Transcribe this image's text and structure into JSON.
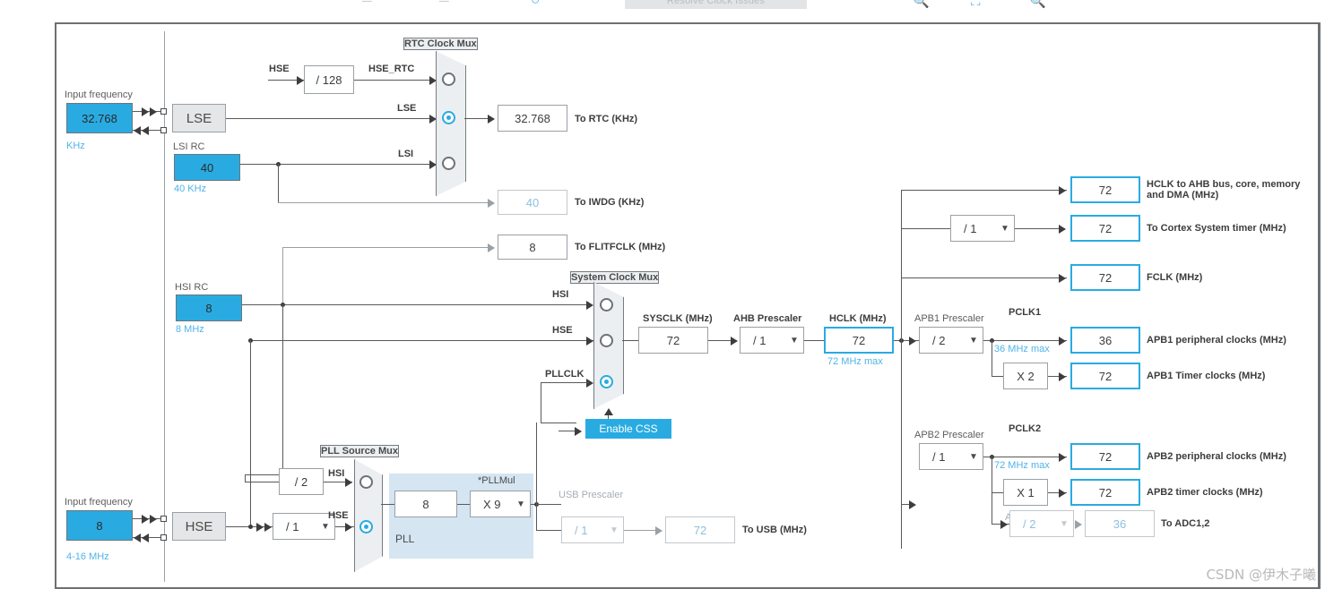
{
  "toolbar": {
    "resolve_label": "Resolve Clock Issues",
    "icons": [
      "minus-icon",
      "minus-icon",
      "circle-refresh-icon",
      "zoom-out-icon",
      "fit-screen-icon",
      "zoom-in-icon"
    ]
  },
  "watermark": "CSDN @伊木子曦",
  "colors": {
    "accent": "#29abe2",
    "wire": "#595959",
    "disabled_text": "#8ebfe0",
    "pll_background": "#d5e5f2",
    "source_box": "#29abe2"
  },
  "lse": {
    "input_frequency_label": "Input frequency",
    "value": "32.768",
    "unit_label": "KHz",
    "osc_label": "LSE"
  },
  "lsi": {
    "title": "LSI RC",
    "value": "40",
    "sub": "40 KHz"
  },
  "hsi": {
    "title": "HSI RC",
    "value": "8",
    "sub": "8 MHz"
  },
  "hse": {
    "input_frequency_label": "Input frequency",
    "value": "8",
    "range_label": "4-16 MHz",
    "osc_label": "HSE"
  },
  "rtc_mux": {
    "title": "RTC Clock Mux",
    "hse_label": "HSE",
    "divider": "/ 128",
    "hse_rtc_label": "HSE_RTC",
    "lse_label": "LSE",
    "lsi_label": "LSI",
    "selected": "LSE"
  },
  "outputs": {
    "to_rtc": {
      "value": "32.768",
      "label": "To RTC (KHz)"
    },
    "to_iwdg": {
      "value": "40",
      "label": "To IWDG (KHz)"
    },
    "to_flitfclk": {
      "value": "8",
      "label": "To FLITFCLK (MHz)"
    },
    "to_usb": {
      "value": "72",
      "label": "To USB (MHz)"
    },
    "to_adc": {
      "value": "36",
      "label": "To ADC1,2"
    },
    "hclk_ahb": {
      "value": "72",
      "label": "HCLK to AHB bus, core, memory and DMA (MHz)"
    },
    "cortex_timer": {
      "value": "72",
      "label": "To Cortex System timer (MHz)"
    },
    "fclk": {
      "value": "72",
      "label": "FCLK (MHz)"
    },
    "apb1_periph": {
      "value": "36",
      "label": "APB1 peripheral clocks (MHz)"
    },
    "apb1_timer": {
      "value": "72",
      "label": "APB1 Timer clocks (MHz)"
    },
    "apb2_periph": {
      "value": "72",
      "label": "APB2 peripheral clocks (MHz)"
    },
    "apb2_timer": {
      "value": "72",
      "label": "APB2 timer clocks (MHz)"
    }
  },
  "system_clock_mux": {
    "title": "System Clock Mux",
    "hsi_label": "HSI",
    "hse_label": "HSE",
    "pllclk_label": "PLLCLK",
    "selected": "PLLCLK"
  },
  "css": {
    "label": "Enable CSS"
  },
  "sysclk": {
    "title": "SYSCLK (MHz)",
    "value": "72"
  },
  "ahb_prescaler": {
    "title": "AHB Prescaler",
    "value": "/ 1"
  },
  "hclk": {
    "title": "HCLK (MHz)",
    "value": "72",
    "max": "72 MHz max"
  },
  "cortex_prescaler": {
    "value": "/ 1"
  },
  "apb1": {
    "title": "APB1 Prescaler",
    "value": "/ 2",
    "pclk_label": "PCLK1",
    "max": "36 MHz max",
    "timer_mul": "X 2"
  },
  "apb2": {
    "title": "APB2 Prescaler",
    "value": "/ 1",
    "pclk_label": "PCLK2",
    "max": "72 MHz max",
    "timer_mul": "X 1"
  },
  "adc_prescaler": {
    "title": "ADC Prescaler",
    "value": "/ 2"
  },
  "pll_source_mux": {
    "title": "PLL Source Mux",
    "hsi_divider": "/ 2",
    "hsi_label": "HSI",
    "hse_divider": "/ 1",
    "hse_label": "HSE",
    "selected": "HSE"
  },
  "pll": {
    "group_label": "PLL",
    "input_value": "8",
    "mul_label": "*PLLMul",
    "mul_value": "X 9"
  },
  "usb_prescaler": {
    "title": "USB Prescaler",
    "value": "/ 1"
  }
}
